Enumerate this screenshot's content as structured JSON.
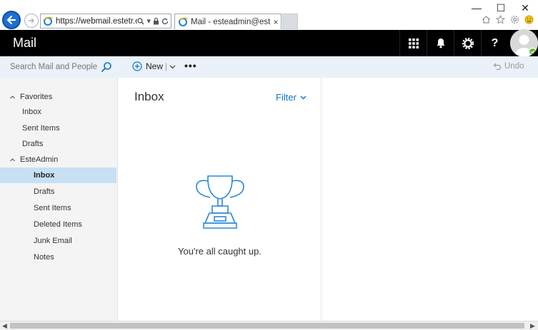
{
  "browser": {
    "url": "https://webmail.estetr.com/",
    "tab_title": "Mail - esteadmin@estetr.co...",
    "tab_close": "×",
    "minimize": "—",
    "maximize": "☐",
    "close": "✕"
  },
  "header": {
    "app_name": "Mail",
    "icons": [
      "app-launcher-icon",
      "bell-icon",
      "gear-icon",
      "help-icon"
    ],
    "help_label": "?"
  },
  "toolbar": {
    "search_placeholder": "Search Mail and People",
    "new_label": "New",
    "new_separator": "|",
    "more_label": "•••",
    "undo_label": "Undo"
  },
  "sidebar": {
    "favorites_label": "Favorites",
    "favorites": [
      {
        "label": "Inbox"
      },
      {
        "label": "Sent Items"
      },
      {
        "label": "Drafts"
      }
    ],
    "account_label": "EsteAdmin",
    "folders": [
      {
        "label": "Inbox",
        "selected": true
      },
      {
        "label": "Drafts"
      },
      {
        "label": "Sent Items"
      },
      {
        "label": "Deleted Items"
      },
      {
        "label": "Junk Email"
      },
      {
        "label": "Notes"
      }
    ]
  },
  "message_list": {
    "title": "Inbox",
    "filter_label": "Filter",
    "empty_message": "You're all caught up."
  },
  "colors": {
    "header_bg": "#000000",
    "accent": "#0a74c9",
    "selected_bg": "#c7e0f4",
    "command_bar_bg": "#eaf1f8",
    "sidebar_bg": "#f4f4f4"
  }
}
